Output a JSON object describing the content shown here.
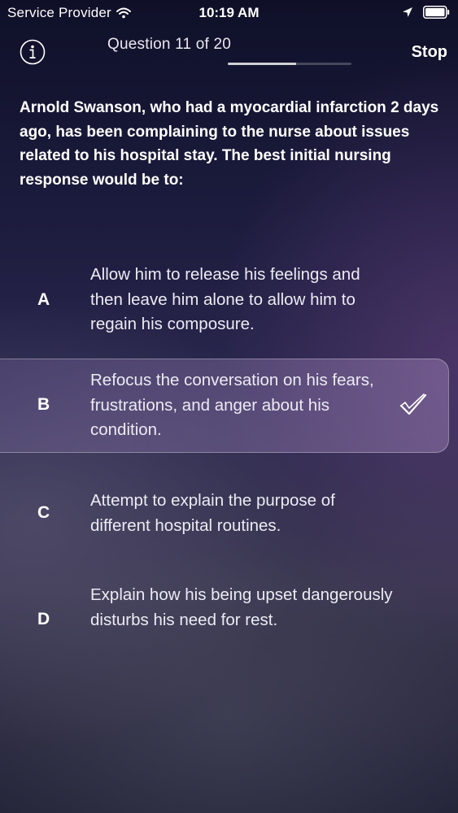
{
  "status_bar": {
    "carrier": "Service Provider",
    "time": "10:19 AM"
  },
  "nav": {
    "info_icon": "info-icon",
    "question_counter": "Question 11 of 20",
    "progress_fraction": 0.55,
    "stop_label": "Stop"
  },
  "question": {
    "text": "Arnold Swanson, who had a myocardial infarction 2 days ago, has been complaining to the nurse about issues related to his hospital stay. The best initial nursing response would be to:"
  },
  "options": [
    {
      "letter": "A",
      "text": "Allow him to release his feelings and then leave him alone to allow him to regain his composure.",
      "selected": false
    },
    {
      "letter": "B",
      "text": "Refocus the conversation on his fears, frustrations, and anger about his condition.",
      "selected": true
    },
    {
      "letter": "C",
      "text": "Attempt to explain the purpose of different hospital routines.",
      "selected": false
    },
    {
      "letter": "D",
      "text": "Explain how his being upset dangerously disturbs his need for rest.",
      "selected": false
    }
  ],
  "colors": {
    "background_top": "#0f1028",
    "background_bottom": "#25263a",
    "selected_card": "#8c78af",
    "text": "#ffffff"
  }
}
